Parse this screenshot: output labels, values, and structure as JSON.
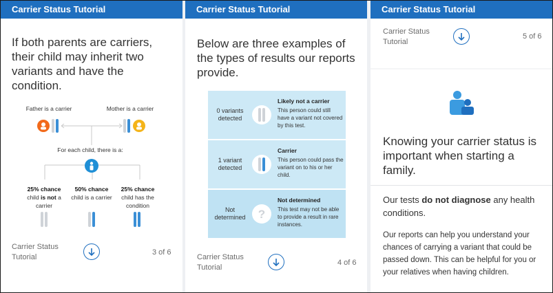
{
  "panels": [
    {
      "header": "Carrier Status Tutorial",
      "heading": "If both parents are carriers, their child may inherit two variants and have the condition.",
      "father_label": "Father is a carrier",
      "mother_label": "Mother is a carrier",
      "each_child": "For each child, there is a:",
      "outcomes": [
        {
          "chance": "25% chance",
          "desc_pre": "child ",
          "desc_bold": "is not",
          "desc_post": " a carrier"
        },
        {
          "chance": "50% chance",
          "desc_pre": "child is a carrier",
          "desc_bold": "",
          "desc_post": ""
        },
        {
          "chance": "25% chance",
          "desc_pre": "child has the condition",
          "desc_bold": "",
          "desc_post": ""
        }
      ],
      "footer_title": "Carrier Status Tutorial",
      "page": "3 of 6"
    },
    {
      "header": "Carrier Status Tutorial",
      "heading": "Below are three examples of the types of results our reports provide.",
      "rows": [
        {
          "label": "0 variants detected",
          "title": "Likely not a carrier",
          "desc": "This person could still have a variant not covered by this test.",
          "icon": "chromosome-icon"
        },
        {
          "label": "1 variant detected",
          "title": "Carrier",
          "desc": "This person could pass the variant on to his or her child.",
          "icon": "chromosome-variant-icon"
        },
        {
          "label": "Not determined",
          "title": "Not determined",
          "desc": "This test may not be able to provide a result in rare instances.",
          "icon": "question-icon"
        }
      ],
      "footer_title": "Carrier Status Tutorial",
      "page": "4 of 6"
    },
    {
      "header": "Carrier Status Tutorial",
      "top_title": "Carrier Status Tutorial",
      "top_page": "5 of 6",
      "heading": "Knowing your carrier status is important when starting a family.",
      "p1_pre": "Our tests ",
      "p1_bold": "do not diagnose",
      "p1_post": " any health conditions.",
      "p2": "Our reports can help you understand your chances of carrying a variant that could be passed down. This can be helpful for you or your relatives when having children."
    }
  ],
  "colors": {
    "brand_blue": "#1f6fbf",
    "light_blue": "#cde9f6",
    "mid_blue": "#bfe2f3",
    "orange": "#f26a1b",
    "yellow": "#f4b41a",
    "variant_blue": "#3b8fd6"
  }
}
